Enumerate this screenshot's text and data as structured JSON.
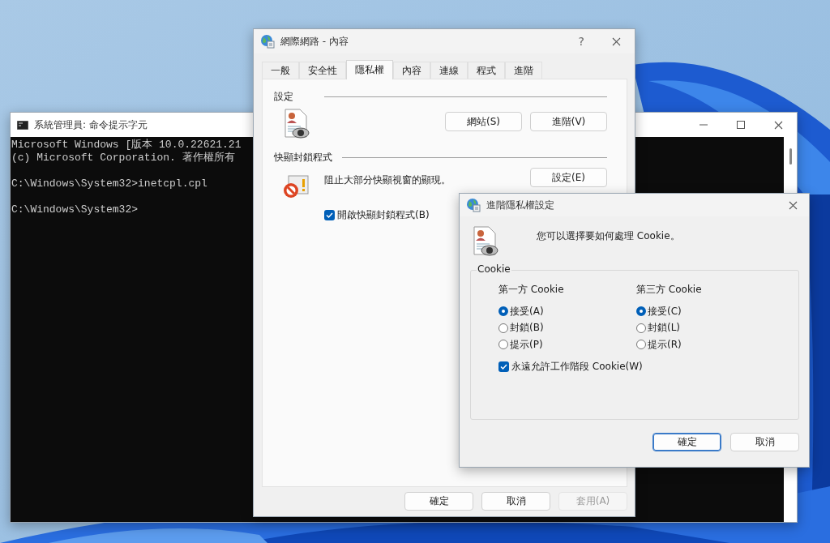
{
  "cmd_window": {
    "title": "系統管理員: 命令提示字元",
    "paragraphs": [
      [
        "Microsoft Windows [版本 10.0.22621.21",
        "(c) Microsoft Corporation. 著作權所有"
      ],
      [
        "C:\\Windows\\System32>inetcpl.cpl"
      ],
      [
        "C:\\Windows\\System32>"
      ]
    ]
  },
  "internet_options": {
    "title": "網際網路 - 內容",
    "help": "?",
    "tabs": [
      {
        "label": "一般",
        "selected": false
      },
      {
        "label": "安全性",
        "selected": false
      },
      {
        "label": "隱私權",
        "selected": true
      },
      {
        "label": "內容",
        "selected": false
      },
      {
        "label": "連線",
        "selected": false
      },
      {
        "label": "程式",
        "selected": false
      },
      {
        "label": "進階",
        "selected": false
      }
    ],
    "settings": {
      "heading": "設定",
      "buttons": [
        "網站(S)",
        "進階(V)"
      ]
    },
    "popup_blocker": {
      "heading": "快顯封鎖程式",
      "description": "阻止大部分快顯視窗的顯現。",
      "button": "設定(E)",
      "checkbox": {
        "label": "開啟快顯封鎖程式(B)",
        "checked": true
      }
    },
    "buttons": [
      {
        "label": "確定",
        "disabled": false
      },
      {
        "label": "取消",
        "disabled": false
      },
      {
        "label": "套用(A)",
        "disabled": true
      }
    ]
  },
  "advanced_privacy": {
    "title": "進階隱私權設定",
    "description": "您可以選擇要如何處理 Cookie。",
    "group": "Cookie",
    "columns": [
      {
        "heading": "第一方 Cookie",
        "options": [
          {
            "label": "接受(A)",
            "selected": true
          },
          {
            "label": "封鎖(B)",
            "selected": false
          },
          {
            "label": "提示(P)",
            "selected": false
          }
        ]
      },
      {
        "heading": "第三方 Cookie",
        "options": [
          {
            "label": "接受(C)",
            "selected": true
          },
          {
            "label": "封鎖(L)",
            "selected": false
          },
          {
            "label": "提示(R)",
            "selected": false
          }
        ]
      }
    ],
    "checkbox": {
      "label": "永遠允許工作階段 Cookie(W)",
      "checked": true
    },
    "buttons": [
      {
        "label": "確定",
        "default": true
      },
      {
        "label": "取消",
        "default": false
      }
    ]
  }
}
